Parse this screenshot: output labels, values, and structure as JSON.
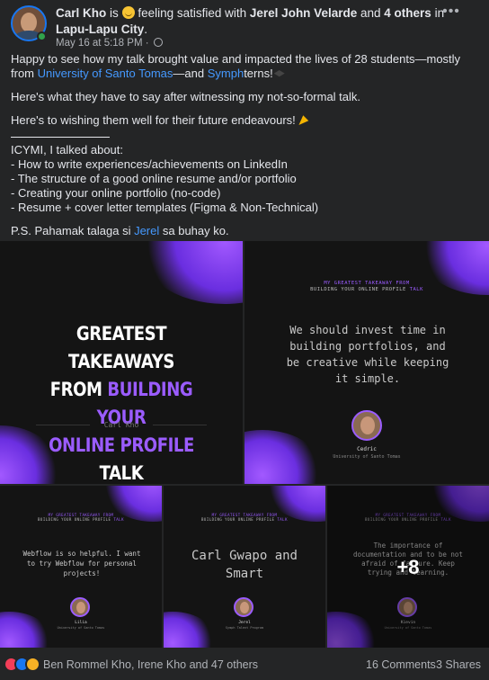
{
  "post": {
    "author": "Carl Kho",
    "is_word": "is",
    "feeling": "feeling satisfied with",
    "tagged": "Jerel John Velarde",
    "and_word": "and",
    "others": "4 others",
    "in_word": "in",
    "location": "Lapu-Lapu City",
    "period": ".",
    "timestamp": "May 16 at 5:18 PM",
    "dot": "·",
    "more_label": "•••"
  },
  "body": {
    "p1_a": "Happy to see how my talk brought value and impacted the lives of 28 students—mostly from ",
    "p1_link1": "University of Santo Tomas",
    "p1_b": "—and ",
    "p1_link2": "Symph",
    "p1_c": "terns!",
    "p2": "Here's what they have to say after witnessing my not-so-formal talk.",
    "p3": "Here's to wishing them well for their future endeavours!",
    "icymi": "ICYMI, I talked about:",
    "bullets": [
      "- How to write experiences/achievements on LinkedIn",
      "- The structure of a good online resume and/or portfolio",
      "- Creating your online portfolio (no-code)",
      "- Resume + cover letter templates (Figma & Non-Technical)"
    ],
    "ps_a": "P.S. Pahamak talaga si ",
    "ps_link": "Jerel",
    "ps_b": " sa buhay ko."
  },
  "media": {
    "t1": {
      "line1": "GREATEST TAKEAWAYS",
      "line2a": "FROM ",
      "line2b": "BUILDING YOUR",
      "line3a": "ONLINE PROFILE",
      "line3b": " TALK",
      "signature": "Carl Kho"
    },
    "kicker1": "MY GREATEST TAKEAWAY FROM",
    "kicker2a": "BUILDING YOUR ONLINE PROFILE ",
    "kicker2b": "TALK",
    "t2": {
      "quote": "We should invest time in building portfolios, and be creative while keeping it simple.",
      "name": "Cedric",
      "school": "University of Santo Tomas"
    },
    "t3": {
      "quote": "Webflow is so helpful. I want to try Webflow for personal projects!",
      "name": "Lilia",
      "school": "University of Santo Tomas"
    },
    "t4": {
      "quote": "Carl Gwapo and Smart",
      "name": "Jerel",
      "school": "Symph Talent Program"
    },
    "t5": {
      "quote": "The importance of documentation and to be not afraid of failure. Keep trying and learning.",
      "name": "Kievin",
      "school": "University of Santo Tomas"
    },
    "more_count": "+8"
  },
  "footer": {
    "reactors": "Ben Rommel Kho, Irene Kho and 47 others",
    "comments": "16 Comments",
    "shares": "3 Shares"
  },
  "colors": {
    "accent_purple": "#9b5cff",
    "link_blue": "#4599ff",
    "background": "#242526"
  }
}
